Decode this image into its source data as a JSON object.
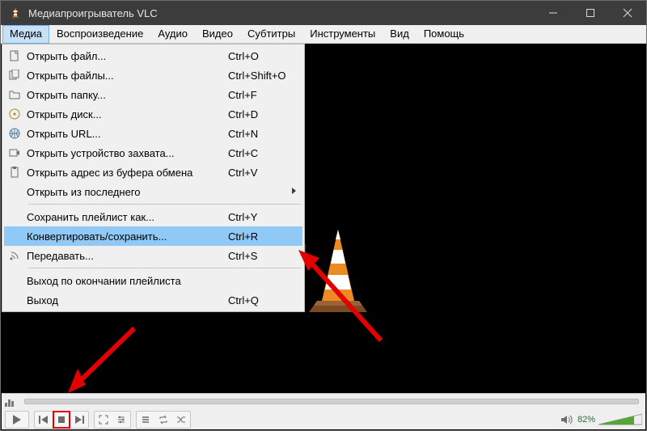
{
  "title": "Медиапроигрыватель VLC",
  "menubar": [
    "Медиа",
    "Воспроизведение",
    "Аудио",
    "Видео",
    "Субтитры",
    "Инструменты",
    "Вид",
    "Помощь"
  ],
  "active_menu_index": 0,
  "dropdown": {
    "items": [
      {
        "label": "Открыть файл...",
        "shortcut": "Ctrl+O",
        "icon": "file"
      },
      {
        "label": "Открыть файлы...",
        "shortcut": "Ctrl+Shift+O",
        "icon": "files"
      },
      {
        "label": "Открыть папку...",
        "shortcut": "Ctrl+F",
        "icon": "folder"
      },
      {
        "label": "Открыть диск...",
        "shortcut": "Ctrl+D",
        "icon": "disc"
      },
      {
        "label": "Открыть URL...",
        "shortcut": "Ctrl+N",
        "icon": "network"
      },
      {
        "label": "Открыть устройство захвата...",
        "shortcut": "Ctrl+C",
        "icon": "capture"
      },
      {
        "label": "Открыть адрес из буфера обмена",
        "shortcut": "Ctrl+V",
        "icon": "clipboard"
      },
      {
        "label": "Открыть из последнего",
        "submenu": true,
        "icon": "none"
      }
    ],
    "group2": [
      {
        "label": "Сохранить плейлист как...",
        "shortcut": "Ctrl+Y",
        "icon": "none"
      },
      {
        "label": "Конвертировать/сохранить...",
        "shortcut": "Ctrl+R",
        "icon": "none",
        "highlight": true
      },
      {
        "label": "Передавать...",
        "shortcut": "Ctrl+S",
        "icon": "stream"
      }
    ],
    "group3": [
      {
        "label": "Выход по окончании плейлиста",
        "icon": "none"
      },
      {
        "label": "Выход",
        "shortcut": "Ctrl+Q",
        "icon": "none"
      }
    ]
  },
  "volume_percent": "82%"
}
